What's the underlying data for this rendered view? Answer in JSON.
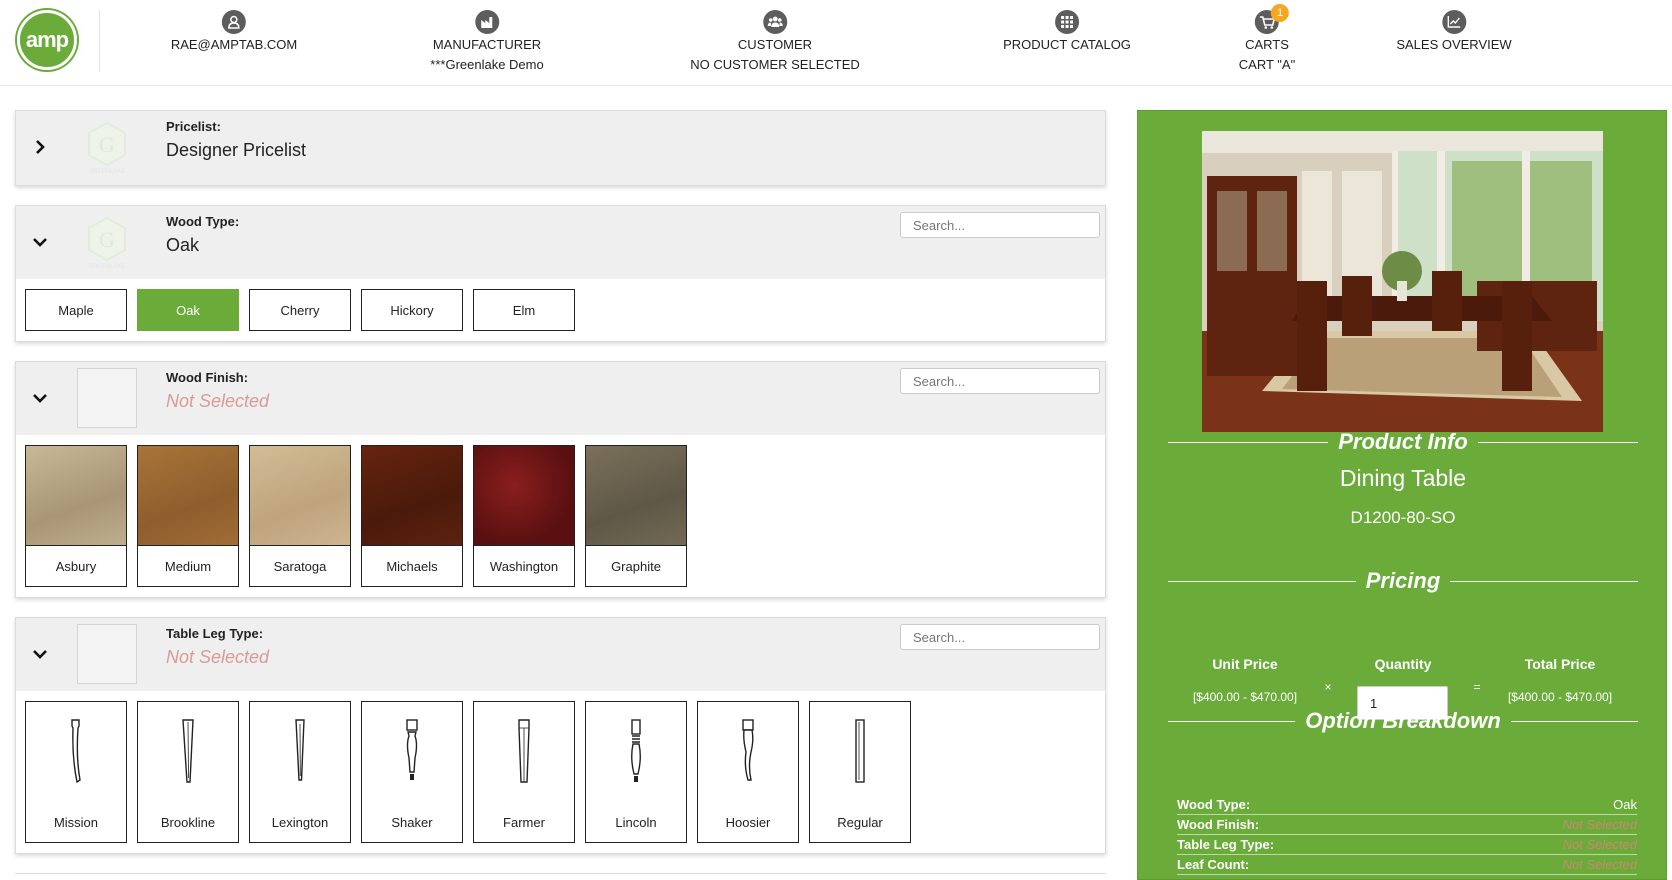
{
  "header": {
    "logo_text": "amp",
    "nav": [
      {
        "icon": "user-icon",
        "line1": "RAE@AMPTAB.COM",
        "line2": ""
      },
      {
        "icon": "factory-icon",
        "line1": "MANUFACTURER",
        "line2": "***Greenlake Demo"
      },
      {
        "icon": "users-icon",
        "line1": "CUSTOMER",
        "line2": "NO CUSTOMER SELECTED"
      },
      {
        "icon": "grid-icon",
        "line1": "PRODUCT CATALOG",
        "line2": ""
      },
      {
        "icon": "cart-icon",
        "line1": "CARTS",
        "line2": "CART \"A\"",
        "badge": "1"
      },
      {
        "icon": "chart-icon",
        "line1": "SALES OVERVIEW",
        "line2": ""
      }
    ]
  },
  "panels": {
    "pricelist": {
      "label": "Pricelist:",
      "value": "Designer Pricelist"
    },
    "wood_type": {
      "label": "Wood Type:",
      "value": "Oak",
      "search_placeholder": "Search...",
      "options": [
        "Maple",
        "Oak",
        "Cherry",
        "Hickory",
        "Elm"
      ],
      "selected": "Oak"
    },
    "wood_finish": {
      "label": "Wood Finish:",
      "value": "Not Selected",
      "search_placeholder": "Search...",
      "options": [
        {
          "name": "Asbury",
          "color": "#b9a88a"
        },
        {
          "name": "Medium",
          "color": "#9c6a34"
        },
        {
          "name": "Saratoga",
          "color": "#c8b08a"
        },
        {
          "name": "Michaels",
          "color": "#5a1e0c"
        },
        {
          "name": "Washington",
          "color": "#6b1414"
        },
        {
          "name": "Graphite",
          "color": "#6c6450"
        }
      ]
    },
    "leg_type": {
      "label": "Table Leg Type:",
      "value": "Not Selected",
      "search_placeholder": "Search...",
      "options": [
        "Mission",
        "Brookline",
        "Lexington",
        "Shaker",
        "Farmer",
        "Lincoln",
        "Hoosier",
        "Regular"
      ]
    }
  },
  "sidebar": {
    "product_info_title": "Product Info",
    "product_name": "Dining Table",
    "product_sku": "D1200-80-SO",
    "pricing_title": "Pricing",
    "unit_price_label": "Unit Price",
    "unit_price": "[$400.00 - $470.00]",
    "quantity_label": "Quantity",
    "quantity": "1",
    "total_price_label": "Total Price",
    "total_price": "[$400.00 - $470.00]",
    "times": "×",
    "equals": "=",
    "breakdown_title": "Option Breakdown",
    "breakdown": [
      {
        "label": "Wood Type:",
        "value": "Oak"
      },
      {
        "label": "Wood Finish:",
        "value": "Not Selected"
      },
      {
        "label": "Table Leg Type:",
        "value": "Not Selected"
      },
      {
        "label": "Leaf Count:",
        "value": "Not Selected"
      }
    ]
  }
}
